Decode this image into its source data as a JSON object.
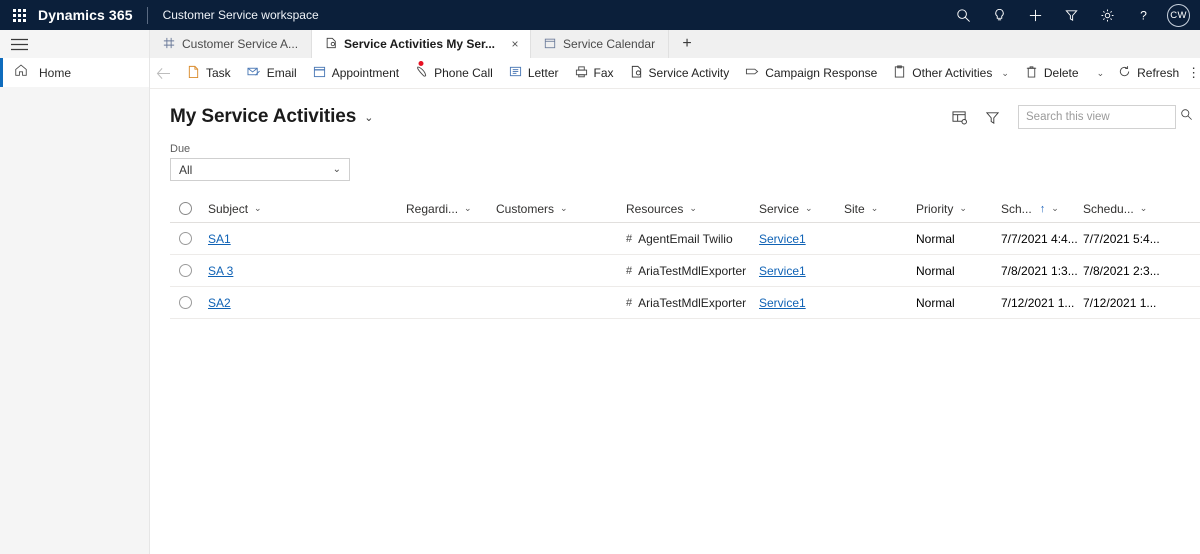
{
  "topnav": {
    "waffle_icon": "waffle-grid-icon",
    "brand": "Dynamics 365",
    "app_name": "Customer Service workspace",
    "icons": [
      {
        "name": "search-icon",
        "label": "Search"
      },
      {
        "name": "lightbulb-icon",
        "label": "Assistant"
      },
      {
        "name": "plus-icon",
        "label": "New"
      },
      {
        "name": "filter-icon",
        "label": "Filter"
      },
      {
        "name": "gear-icon",
        "label": "Settings"
      },
      {
        "name": "help-icon",
        "label": "Help"
      }
    ],
    "avatar_initials": "CW",
    "background_color": "#0b1f3a"
  },
  "sidebar": {
    "hamburger_icon": "hamburger-icon",
    "items": [
      {
        "label": "Home",
        "icon": "home-icon",
        "active": true
      }
    ]
  },
  "tabs": {
    "items": [
      {
        "label": "Customer Service A...",
        "icon": "dashboard-icon",
        "active": false,
        "closable": false
      },
      {
        "label": "Service Activities My Ser...",
        "icon": "service-activity-icon",
        "active": true,
        "closable": true,
        "unsaved": true
      },
      {
        "label": "Service Calendar",
        "icon": "calendar-icon",
        "active": false,
        "closable": false
      }
    ],
    "add_label": "+",
    "close_label": "×",
    "unsaved_color": "#e81123"
  },
  "commandbar": {
    "back_label": "←",
    "commands": [
      {
        "label": "Task",
        "icon": "task-icon",
        "dropdown": false
      },
      {
        "label": "Email",
        "icon": "email-icon",
        "dropdown": false
      },
      {
        "label": "Appointment",
        "icon": "appointment-icon",
        "dropdown": false
      },
      {
        "label": "Phone Call",
        "icon": "phone-icon",
        "dropdown": false
      },
      {
        "label": "Letter",
        "icon": "letter-icon",
        "dropdown": false
      },
      {
        "label": "Fax",
        "icon": "fax-icon",
        "dropdown": false
      },
      {
        "label": "Service Activity",
        "icon": "service-activity-icon",
        "dropdown": false
      },
      {
        "label": "Campaign Response",
        "icon": "campaign-response-icon",
        "dropdown": false
      },
      {
        "label": "Other Activities",
        "icon": "other-activities-icon",
        "dropdown": true
      },
      {
        "label": "Delete",
        "icon": "trash-icon",
        "dropdown": true,
        "split": true
      },
      {
        "label": "Refresh",
        "icon": "refresh-icon",
        "dropdown": false
      }
    ],
    "overflow_label": "⋮",
    "chevron": "⌄"
  },
  "view": {
    "title": "My Service Activities",
    "title_chevron": "⌄",
    "edit_columns_icon": "edit-columns-icon",
    "filter_icon": "filter-icon",
    "search": {
      "placeholder": "Search this view",
      "value": "",
      "icon": "search-icon"
    }
  },
  "due_filter": {
    "label": "Due",
    "value": "All",
    "chevron": "⌄"
  },
  "grid": {
    "select_all_name": "select-all-radio",
    "sort_indicator": "↑",
    "header_chevron": "⌄",
    "columns": [
      {
        "key": "subject",
        "label": "Subject",
        "sorted": false
      },
      {
        "key": "regarding",
        "label": "Regardi...",
        "sorted": false
      },
      {
        "key": "customers",
        "label": "Customers",
        "sorted": false
      },
      {
        "key": "resources",
        "label": "Resources",
        "sorted": false
      },
      {
        "key": "service",
        "label": "Service",
        "sorted": false
      },
      {
        "key": "site",
        "label": "Site",
        "sorted": false
      },
      {
        "key": "priority",
        "label": "Priority",
        "sorted": false
      },
      {
        "key": "sch",
        "label": "Sch...",
        "sorted": true
      },
      {
        "key": "schedu",
        "label": "Schedu...",
        "sorted": false
      }
    ],
    "rows": [
      {
        "subject": "SA1",
        "regarding": "",
        "customers": "",
        "resources": "AgentEmail Twilio",
        "resources_glyph": "#",
        "service": "Service1",
        "site": "",
        "priority": "Normal",
        "sch": "7/7/2021 4:4...",
        "schedu": "7/7/2021 5:4..."
      },
      {
        "subject": "SA 3",
        "regarding": "",
        "customers": "",
        "resources": "AriaTestMdlExporter",
        "resources_glyph": "#",
        "service": "Service1",
        "site": "",
        "priority": "Normal",
        "sch": "7/8/2021 1:3...",
        "schedu": "7/8/2021 2:3..."
      },
      {
        "subject": "SA2",
        "regarding": "",
        "customers": "",
        "resources": "AriaTestMdlExporter",
        "resources_glyph": "#",
        "service": "Service1",
        "site": "",
        "priority": "Normal",
        "sch": "7/12/2021 1...",
        "schedu": "7/12/2021 1..."
      }
    ]
  },
  "colors": {
    "link": "#0f62b5",
    "accent": "#0f6cbd",
    "nav_bg": "#0b1f3a"
  }
}
